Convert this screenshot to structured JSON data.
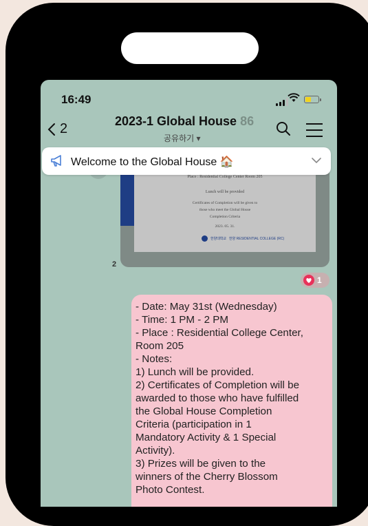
{
  "status_bar": {
    "time": "16:49"
  },
  "header": {
    "back_count": "2",
    "title": "2023-1 Global House",
    "member_count": "86",
    "subtitle": "공유하기 ▾"
  },
  "notice": {
    "text": "Welcome to the Global House 🏠"
  },
  "photo": {
    "lines": [
      "Place : Residential College Center Room 205",
      "Lunch will be provided",
      "Certificates of Completion will be given to",
      "those who meet the Global House",
      "Completion Criteria",
      "2023. 05. 31."
    ],
    "logo_text_1": "한양대학교",
    "logo_text_2": "한양 RESIDENTIAL COLLEGE (RC)"
  },
  "message_meta": {
    "read_count": "2",
    "reaction_count": "1"
  },
  "message": {
    "lines": [
      "- Date: May 31st (Wednesday)",
      "- Time: 1 PM - 2 PM",
      "- Place : Residential College Center,",
      "Room 205",
      "- Notes:",
      "1) Lunch will be provided.",
      "2) Certificates of Completion will be",
      "awarded to those who have fulfilled",
      "the Global House Completion",
      "Criteria (participation in 1",
      "Mandatory Activity & 1 Special",
      "Activity).",
      "3) Prizes will be given to the",
      "winners of the Cherry Blossom",
      "Photo Contest."
    ]
  },
  "colors": {
    "chat_background": "#a9c6bb",
    "my_bubble": "#f7c6d0",
    "reaction_heart": "#e8325a",
    "battery": "#f2d21b"
  },
  "icons": [
    "back-chevron-icon",
    "search-icon",
    "hamburger-menu-icon",
    "megaphone-icon",
    "chevron-down-icon",
    "signal-icon",
    "wifi-icon",
    "battery-icon",
    "heart-icon"
  ]
}
